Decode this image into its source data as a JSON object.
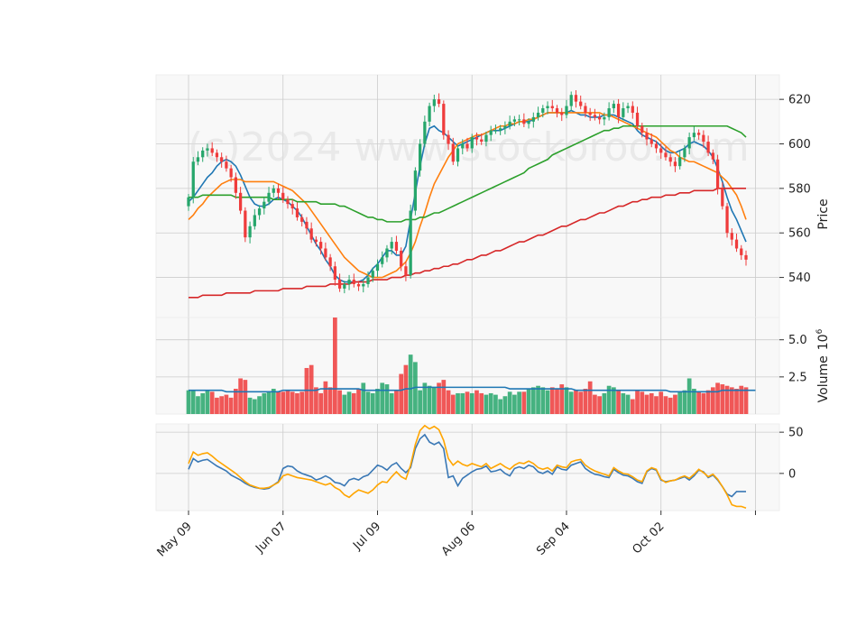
{
  "watermark": "(c)2024 www.stockoroo.com",
  "colors": {
    "up": "#26a66b",
    "down": "#ef3b3b",
    "ma_short": "#1f77b4",
    "ma_mid": "#ff7f0e",
    "ma_long": "#2ca02c",
    "ma_200": "#d62728",
    "osc_fast": "#3a78b5",
    "osc_slow": "#ffa500",
    "panel_bg": "#f8f8f8",
    "grid": "#cccccc"
  },
  "chart_data": [
    {
      "type": "candlestick",
      "panel": "price",
      "ylabel": "Price",
      "ylim": [
        522,
        631
      ],
      "yticks": [
        540,
        560,
        580,
        600,
        620
      ],
      "x_tick_labels": [
        {
          "label": "May 09",
          "index": 0
        },
        {
          "label": "Jun 07",
          "index": 20
        },
        {
          "label": "Jul 09",
          "index": 40
        },
        {
          "label": "Aug 06",
          "index": 60
        },
        {
          "label": "Sep 04",
          "index": 80
        },
        {
          "label": "Oct 02",
          "index": 100
        }
      ],
      "x_extra_tick_index": 120,
      "grid": true,
      "close": [
        576,
        592,
        594,
        597,
        598,
        596,
        594,
        592,
        589,
        585,
        578,
        570,
        558,
        563,
        568,
        571,
        574,
        578,
        580,
        578,
        575,
        573,
        571,
        567,
        565,
        562,
        557,
        556,
        553,
        549,
        545,
        539,
        535,
        537,
        539,
        537,
        536,
        537,
        540,
        543,
        546,
        549,
        553,
        556,
        552,
        545,
        541,
        570,
        588,
        600,
        610,
        617,
        620,
        618,
        604,
        600,
        592,
        598,
        600,
        598,
        603,
        602,
        601,
        604,
        606,
        606,
        607,
        608,
        610,
        611,
        611,
        609,
        610,
        612,
        614,
        616,
        617,
        616,
        614,
        613,
        617,
        622,
        619,
        617,
        614,
        613,
        612,
        611,
        612,
        616,
        618,
        612,
        616,
        617,
        614,
        608,
        605,
        602,
        600,
        598,
        596,
        594,
        592,
        590,
        594,
        598,
        603,
        605,
        604,
        601,
        596,
        593,
        580,
        572,
        560,
        557,
        553,
        550,
        548
      ],
      "volume_millions": [
        1.6,
        1.6,
        1.2,
        1.4,
        1.6,
        1.5,
        1.1,
        1.2,
        1.3,
        1.1,
        1.7,
        2.4,
        2.3,
        1.1,
        1.0,
        1.2,
        1.4,
        1.5,
        1.7,
        1.5,
        1.5,
        1.6,
        1.5,
        1.4,
        1.5,
        3.1,
        3.3,
        1.8,
        1.4,
        2.2,
        1.8,
        6.5,
        1.6,
        1.3,
        1.5,
        1.4,
        1.7,
        2.1,
        1.5,
        1.4,
        1.7,
        2.1,
        2.0,
        1.4,
        1.6,
        2.7,
        3.3,
        4.0,
        3.5,
        1.6,
        2.1,
        1.9,
        1.8,
        2.1,
        2.3,
        1.6,
        1.3,
        1.4,
        1.4,
        1.5,
        1.4,
        1.6,
        1.4,
        1.3,
        1.4,
        1.3,
        1.0,
        1.2,
        1.5,
        1.3,
        1.5,
        1.5,
        1.7,
        1.8,
        1.9,
        1.8,
        1.6,
        1.8,
        1.7,
        2.0,
        1.8,
        1.5,
        1.6,
        1.5,
        1.7,
        2.2,
        1.3,
        1.2,
        1.4,
        1.9,
        1.8,
        1.6,
        1.4,
        1.3,
        1.0,
        1.6,
        1.5,
        1.3,
        1.4,
        1.2,
        1.5,
        1.2,
        1.1,
        1.3,
        1.5,
        1.6,
        2.4,
        1.7,
        1.5,
        1.4,
        1.6,
        1.8,
        2.1,
        2.0,
        1.9,
        1.8,
        1.7,
        1.9,
        1.8,
        1.7,
        1.8
      ],
      "series": [
        {
          "key": "ma_short",
          "values": [
            574,
            576,
            579,
            582,
            585,
            587,
            590,
            592,
            593,
            592,
            590,
            586,
            581,
            576,
            573,
            572,
            572,
            573,
            575,
            576,
            575,
            574,
            572,
            570,
            567,
            563,
            559,
            555,
            552,
            548,
            545,
            541,
            539,
            538,
            538,
            538,
            538,
            539,
            541,
            544,
            546,
            549,
            552,
            552,
            550,
            550,
            554,
            566,
            578,
            590,
            600,
            607,
            608,
            606,
            605,
            603,
            601,
            599,
            600,
            601,
            602,
            603,
            604,
            605,
            606,
            606,
            606,
            607,
            608,
            609,
            610,
            610,
            610,
            611,
            612,
            613,
            614,
            614,
            614,
            614,
            614,
            615,
            614,
            613,
            613,
            612,
            612,
            612,
            613,
            613,
            613,
            612,
            611,
            610,
            609,
            606,
            604,
            603,
            602,
            601,
            599,
            597,
            596,
            596,
            597,
            598,
            600,
            601,
            600,
            599,
            597,
            594,
            589,
            583,
            576,
            570,
            566,
            561,
            556
          ]
        },
        {
          "key": "ma_mid",
          "values": [
            566,
            568,
            571,
            573,
            576,
            578,
            580,
            582,
            583,
            584,
            584,
            584,
            583,
            583,
            583,
            583,
            583,
            583,
            583,
            582,
            581,
            580,
            579,
            577,
            575,
            573,
            570,
            567,
            564,
            561,
            558,
            555,
            552,
            549,
            547,
            545,
            543,
            542,
            541,
            540,
            540,
            540,
            541,
            542,
            543,
            545,
            547,
            551,
            556,
            563,
            569,
            576,
            582,
            586,
            590,
            594,
            597,
            600,
            601,
            602,
            603,
            604,
            604,
            605,
            606,
            607,
            608,
            608,
            609,
            609,
            610,
            610,
            611,
            611,
            612,
            613,
            614,
            614,
            614,
            614,
            614,
            614,
            614,
            614,
            614,
            614,
            614,
            614,
            613,
            613,
            612,
            611,
            610,
            609,
            608,
            607,
            606,
            605,
            604,
            603,
            601,
            599,
            597,
            596,
            594,
            593,
            592,
            592,
            591,
            590,
            589,
            588,
            587,
            585,
            583,
            580,
            577,
            572,
            566
          ]
        },
        {
          "key": "ma_long",
          "values": [
            576,
            576,
            576,
            577,
            577,
            577,
            577,
            577,
            577,
            577,
            576,
            576,
            576,
            576,
            576,
            576,
            576,
            576,
            575,
            575,
            575,
            575,
            575,
            574,
            574,
            574,
            574,
            574,
            573,
            573,
            573,
            573,
            572,
            572,
            571,
            570,
            569,
            568,
            567,
            567,
            566,
            566,
            565,
            565,
            565,
            565,
            566,
            566,
            566,
            567,
            567,
            568,
            569,
            569,
            570,
            571,
            572,
            573,
            574,
            575,
            576,
            577,
            578,
            579,
            580,
            581,
            582,
            583,
            584,
            585,
            586,
            587,
            589,
            590,
            591,
            592,
            593,
            595,
            596,
            597,
            598,
            599,
            600,
            601,
            602,
            603,
            604,
            605,
            606,
            606,
            607,
            607,
            608,
            608,
            608,
            608,
            608,
            608,
            608,
            608,
            608,
            608,
            608,
            608,
            608,
            608,
            608,
            608,
            608,
            608,
            608,
            608,
            608,
            608,
            608,
            607,
            606,
            605,
            603
          ]
        },
        {
          "key": "ma_200",
          "values": [
            531,
            531,
            531,
            532,
            532,
            532,
            532,
            532,
            533,
            533,
            533,
            533,
            533,
            533,
            534,
            534,
            534,
            534,
            534,
            534,
            535,
            535,
            535,
            535,
            535,
            536,
            536,
            536,
            536,
            536,
            537,
            537,
            537,
            537,
            537,
            538,
            538,
            538,
            538,
            539,
            539,
            539,
            539,
            540,
            540,
            540,
            541,
            541,
            542,
            542,
            543,
            543,
            544,
            544,
            545,
            545,
            546,
            546,
            547,
            548,
            548,
            549,
            550,
            550,
            551,
            552,
            552,
            553,
            554,
            555,
            556,
            556,
            557,
            558,
            559,
            559,
            560,
            561,
            562,
            563,
            563,
            564,
            565,
            566,
            566,
            567,
            568,
            569,
            569,
            570,
            571,
            572,
            572,
            573,
            574,
            574,
            575,
            575,
            576,
            576,
            576,
            577,
            577,
            577,
            578,
            578,
            578,
            579,
            579,
            579,
            579,
            579,
            580,
            580,
            580,
            580,
            580,
            580,
            580
          ]
        }
      ]
    },
    {
      "type": "bar",
      "panel": "volume",
      "ylabel": "Volume",
      "ylabel_exponent": "10^6",
      "ylim": [
        0,
        6.5
      ],
      "yticks": [
        2.5,
        5.0
      ],
      "series": [
        {
          "key": "volume_ma",
          "values": [
            1.6,
            1.6,
            1.6,
            1.6,
            1.6,
            1.6,
            1.6,
            1.6,
            1.5,
            1.5,
            1.5,
            1.5,
            1.5,
            1.5,
            1.5,
            1.5,
            1.5,
            1.5,
            1.5,
            1.5,
            1.6,
            1.6,
            1.6,
            1.6,
            1.6,
            1.6,
            1.6,
            1.6,
            1.7,
            1.7,
            1.7,
            1.7,
            1.7,
            1.7,
            1.7,
            1.7,
            1.7,
            1.6,
            1.6,
            1.6,
            1.6,
            1.6,
            1.6,
            1.6,
            1.6,
            1.6,
            1.7,
            1.7,
            1.8,
            1.8,
            1.8,
            1.8,
            1.8,
            1.8,
            1.8,
            1.8,
            1.8,
            1.8,
            1.8,
            1.8,
            1.8,
            1.8,
            1.8,
            1.8,
            1.8,
            1.8,
            1.8,
            1.8,
            1.7,
            1.7,
            1.7,
            1.7,
            1.7,
            1.7,
            1.7,
            1.7,
            1.7,
            1.7,
            1.7,
            1.7,
            1.7,
            1.7,
            1.6,
            1.6,
            1.6,
            1.6,
            1.6,
            1.6,
            1.6,
            1.6,
            1.6,
            1.6,
            1.6,
            1.6,
            1.6,
            1.6,
            1.6,
            1.6,
            1.6,
            1.6,
            1.6,
            1.6,
            1.5,
            1.5,
            1.5,
            1.5,
            1.5,
            1.5,
            1.5,
            1.5,
            1.5,
            1.5,
            1.5,
            1.6,
            1.6,
            1.6,
            1.6,
            1.6,
            1.6,
            1.6,
            1.6
          ]
        }
      ]
    },
    {
      "type": "line",
      "panel": "oscillator",
      "ylim": [
        -45,
        60
      ],
      "yticks": [
        0,
        50
      ],
      "series": [
        {
          "key": "osc_fast",
          "values": [
            5,
            18,
            14,
            16,
            17,
            13,
            9,
            6,
            3,
            -2,
            -5,
            -8,
            -12,
            -15,
            -17,
            -18,
            -19,
            -18,
            -14,
            -10,
            6,
            9,
            8,
            3,
            0,
            -2,
            -4,
            -8,
            -6,
            -3,
            -6,
            -11,
            -12,
            -15,
            -8,
            -6,
            -8,
            -4,
            -2,
            4,
            10,
            8,
            4,
            10,
            13,
            6,
            1,
            7,
            30,
            42,
            47,
            38,
            35,
            38,
            30,
            -5,
            -3,
            -15,
            -6,
            -2,
            2,
            5,
            6,
            9,
            2,
            3,
            5,
            0,
            -3,
            6,
            8,
            6,
            10,
            8,
            2,
            0,
            3,
            -1,
            8,
            5,
            4,
            10,
            12,
            14,
            6,
            2,
            -1,
            -2,
            -4,
            -5,
            5,
            1,
            -2,
            -3,
            -6,
            -10,
            -12,
            2,
            6,
            4,
            -8,
            -10,
            -9,
            -8,
            -6,
            -4,
            -8,
            -3,
            4,
            2,
            -5,
            -2,
            -8,
            -16,
            -25,
            -28,
            -22,
            -22,
            -22
          ]
        },
        {
          "key": "osc_slow",
          "values": [
            12,
            26,
            22,
            24,
            25,
            21,
            16,
            12,
            8,
            4,
            0,
            -5,
            -10,
            -14,
            -16,
            -18,
            -18,
            -17,
            -14,
            -11,
            -3,
            -1,
            -3,
            -5,
            -6,
            -7,
            -8,
            -10,
            -12,
            -14,
            -12,
            -17,
            -20,
            -26,
            -29,
            -24,
            -20,
            -22,
            -24,
            -20,
            -14,
            -10,
            -11,
            -4,
            2,
            -4,
            -7,
            10,
            35,
            52,
            58,
            54,
            57,
            53,
            40,
            18,
            10,
            15,
            11,
            9,
            12,
            10,
            8,
            12,
            6,
            9,
            12,
            8,
            5,
            10,
            13,
            12,
            15,
            12,
            7,
            5,
            7,
            3,
            10,
            8,
            7,
            14,
            16,
            17,
            10,
            6,
            3,
            1,
            -1,
            -3,
            7,
            3,
            0,
            -1,
            -4,
            -8,
            -10,
            3,
            7,
            5,
            -7,
            -11,
            -9,
            -8,
            -5,
            -3,
            -6,
            -1,
            5,
            1,
            -4,
            -1,
            -7,
            -16,
            -26,
            -38,
            -40,
            -40,
            -42
          ]
        }
      ]
    }
  ]
}
